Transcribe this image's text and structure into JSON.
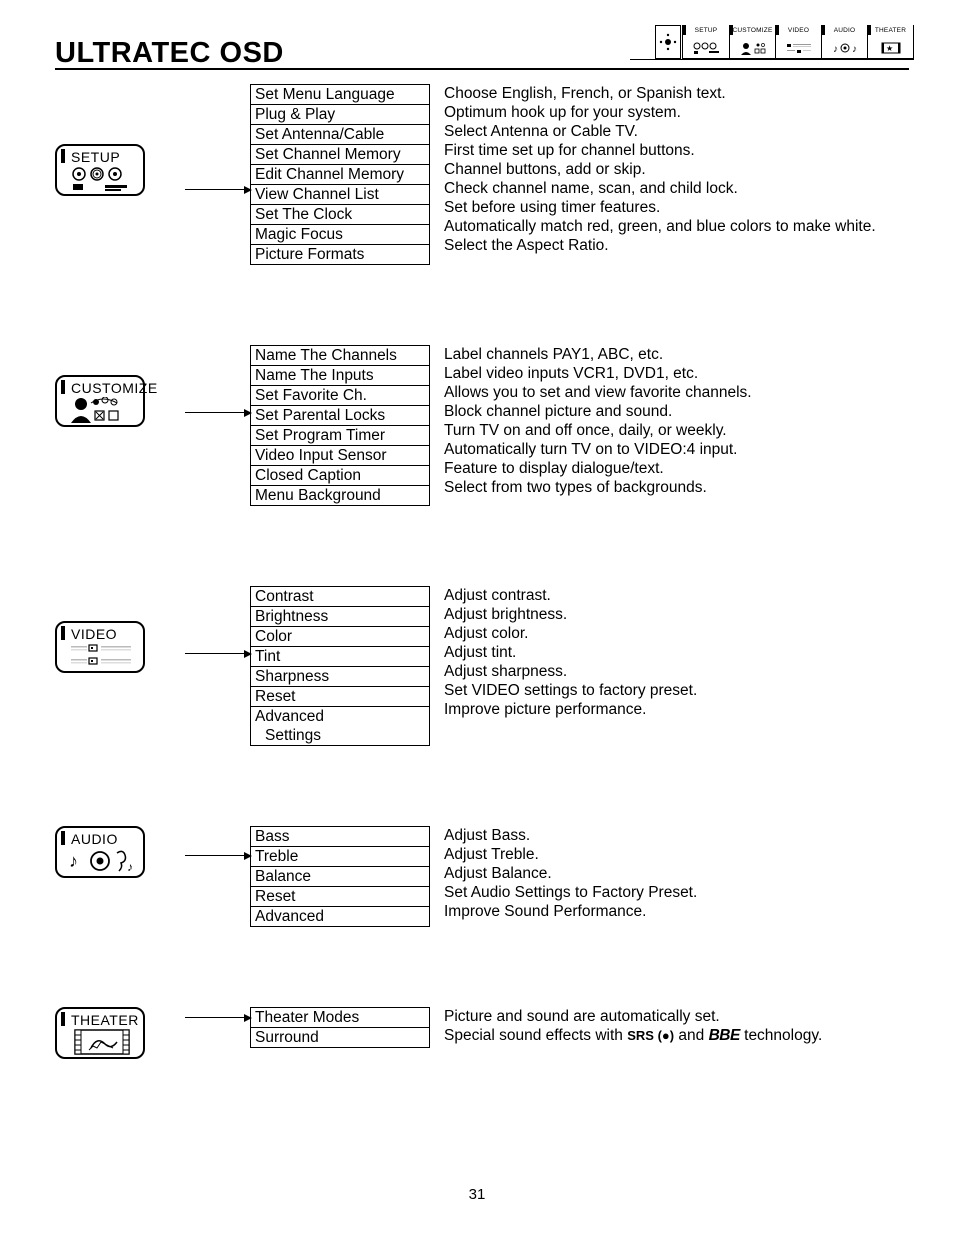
{
  "header": {
    "title": "ULTRATEC OSD",
    "tabs": [
      "SETUP",
      "CUSTOMIZE",
      "VIDEO",
      "AUDIO",
      "THEATER"
    ]
  },
  "sections": [
    {
      "icon_label": "SETUP",
      "arrow_row": 5,
      "items": [
        {
          "label": "Set Menu Language",
          "desc": "Choose English, French, or Spanish text."
        },
        {
          "label": "Plug & Play",
          "desc": "Optimum hook up for your system."
        },
        {
          "label": "Set Antenna/Cable",
          "desc": "Select Antenna or Cable TV."
        },
        {
          "label": "Set Channel Memory",
          "desc": "First time set up for channel buttons."
        },
        {
          "label": "Edit Channel Memory",
          "desc": "Channel buttons, add or skip."
        },
        {
          "label": "View Channel List",
          "desc": "Check channel name, scan, and child lock."
        },
        {
          "label": "Set The Clock",
          "desc": "Set before using timer features."
        },
        {
          "label": "Magic Focus",
          "desc": "Automatically match red, green, and blue colors to make white."
        },
        {
          "label": "Picture Formats",
          "desc": "Select  the Aspect Ratio."
        }
      ]
    },
    {
      "icon_label": "CUSTOMIZE",
      "arrow_row": 3,
      "items": [
        {
          "label": "Name The Channels",
          "desc": "Label channels PAY1, ABC, etc."
        },
        {
          "label": "Name The Inputs",
          "desc": "Label video inputs VCR1, DVD1, etc."
        },
        {
          "label": "Set Favorite Ch.",
          "desc": "Allows you to set and view favorite channels."
        },
        {
          "label": "Set Parental Locks",
          "desc": "Block channel picture and sound."
        },
        {
          "label": "Set Program Timer",
          "desc": "Turn TV on and off once, daily, or weekly."
        },
        {
          "label": "Video Input Sensor",
          "desc": "Automatically turn TV on to VIDEO:4 input."
        },
        {
          "label": "Closed Caption",
          "desc": "Feature to display dialogue/text."
        },
        {
          "label": "Menu Background",
          "desc": "Select from two types of backgrounds."
        }
      ]
    },
    {
      "icon_label": "VIDEO",
      "arrow_row": 3,
      "items": [
        {
          "label": "Contrast",
          "desc": "Adjust contrast."
        },
        {
          "label": "Brightness",
          "desc": "Adjust brightness."
        },
        {
          "label": "Color",
          "desc": "Adjust color."
        },
        {
          "label": "Tint",
          "desc": "Adjust tint."
        },
        {
          "label": "Sharpness",
          "desc": "Adjust sharpness."
        },
        {
          "label": "Reset",
          "desc": "Set VIDEO settings to factory preset."
        },
        {
          "label": "Advanced",
          "desc": "Improve picture performance."
        },
        {
          "label": "  Settings",
          "desc": "",
          "cont": true
        }
      ]
    },
    {
      "icon_label": "AUDIO",
      "arrow_row": 1,
      "items": [
        {
          "label": "Bass",
          "desc": "Adjust Bass."
        },
        {
          "label": "Treble",
          "desc": "Adjust Treble."
        },
        {
          "label": "Balance",
          "desc": "Adjust Balance."
        },
        {
          "label": "Reset",
          "desc": "Set Audio Settings to Factory Preset."
        },
        {
          "label": "Advanced",
          "desc": "Improve Sound Performance."
        }
      ]
    },
    {
      "icon_label": "THEATER",
      "arrow_row": 0,
      "items": [
        {
          "label": "Theater Modes",
          "desc": "Picture and sound are automatically set."
        },
        {
          "label": "Surround",
          "desc_html": "Special sound effects with <span class='srs'>SRS (●)</span> and <span class='logo'>BBE</span> technology."
        }
      ]
    }
  ],
  "page_number": "31"
}
